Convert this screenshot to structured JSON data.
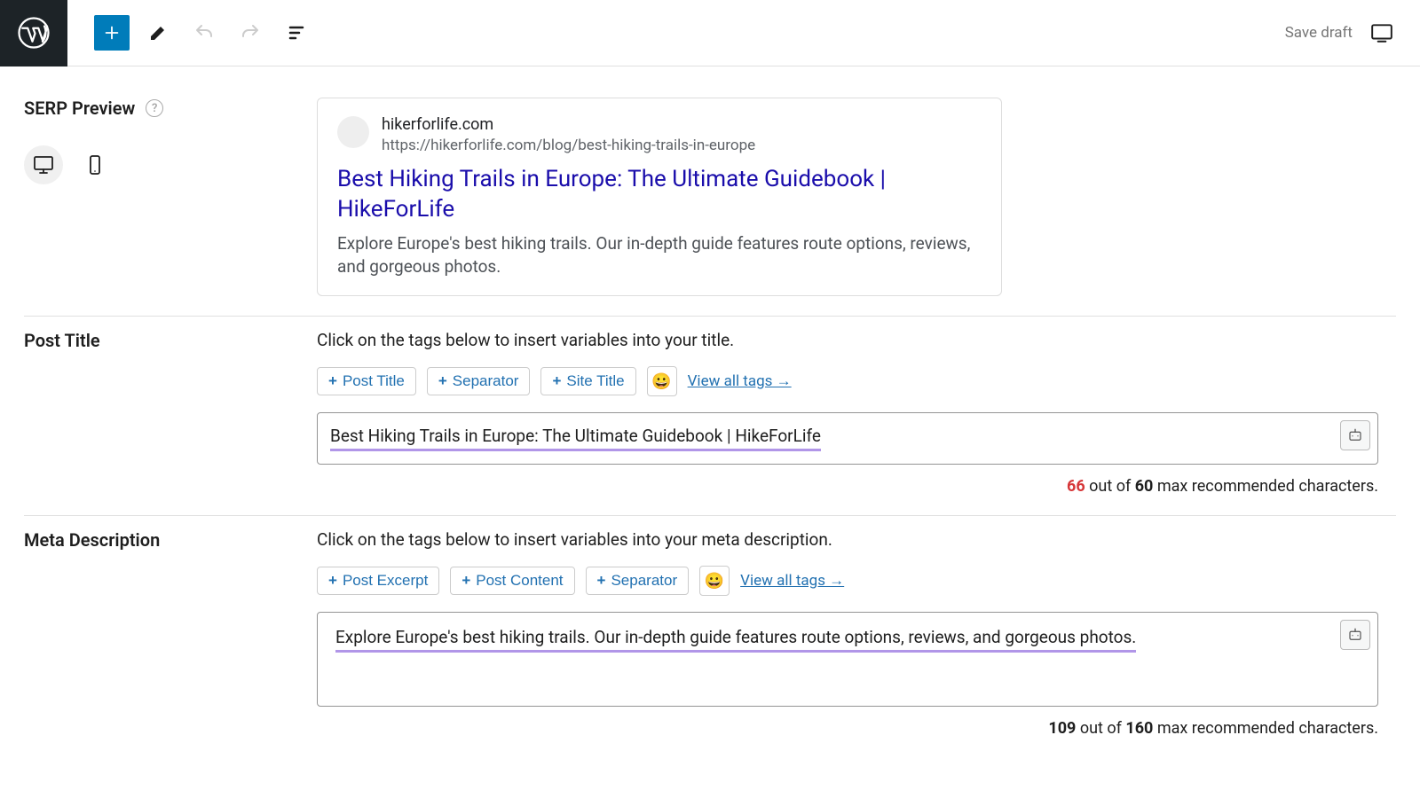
{
  "toolbar": {
    "save_draft_label": "Save draft"
  },
  "serp_preview": {
    "section_label": "SERP Preview",
    "domain": "hikerforlife.com",
    "url": "https://hikerforlife.com/blog/best-hiking-trails-in-europe",
    "title": "Best Hiking Trails in Europe: The Ultimate Guidebook | HikeForLife",
    "description": "Explore Europe's best hiking trails. Our in-depth guide features route options, reviews, and gorgeous photos."
  },
  "post_title": {
    "section_label": "Post Title",
    "instruction": "Click on the tags below to insert variables into your title.",
    "tags": [
      "Post Title",
      "Separator",
      "Site Title"
    ],
    "view_all_label": "View all tags →",
    "value": "Best Hiking Trails in Europe: The Ultimate Guidebook | HikeForLife",
    "count": "66",
    "max": "60",
    "counter_mid": " out of ",
    "counter_suffix": " max recommended characters."
  },
  "meta_description": {
    "section_label": "Meta Description",
    "instruction": "Click on the tags below to insert variables into your meta description.",
    "tags": [
      "Post Excerpt",
      "Post Content",
      "Separator"
    ],
    "view_all_label": "View all tags →",
    "value": "Explore Europe's best hiking trails. Our in-depth guide features route options, reviews, and gorgeous photos.",
    "count": "109",
    "max": "160",
    "counter_mid": " out of ",
    "counter_suffix": " max recommended characters."
  }
}
